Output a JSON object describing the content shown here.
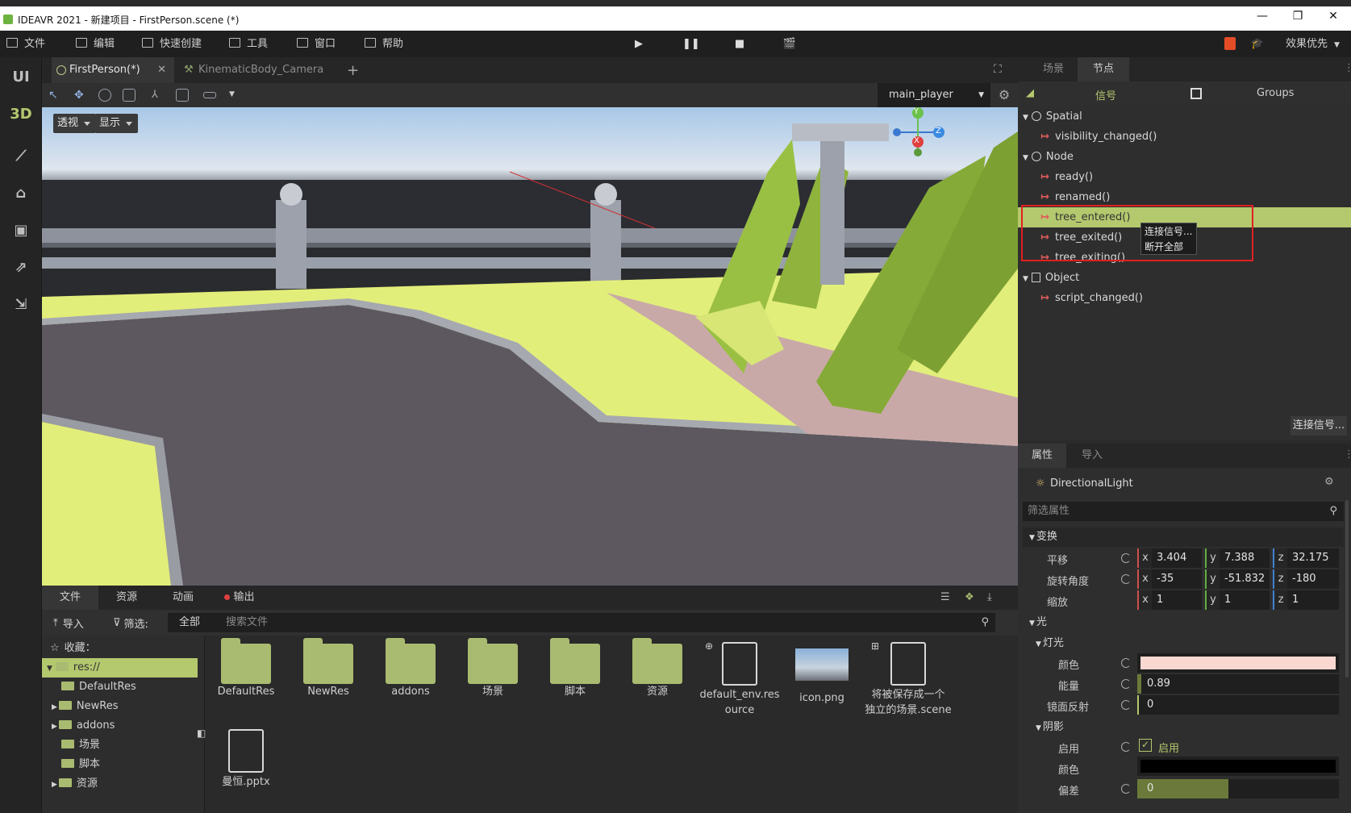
{
  "window": {
    "title": "IDEAVR 2021 - 新建项目 - FirstPerson.scene (*)",
    "controls": [
      "—",
      "❐",
      "✕"
    ]
  },
  "menu": {
    "items": [
      "文件",
      "编辑",
      "快速创建",
      "工具",
      "窗口",
      "帮助"
    ],
    "quality": "效果优先"
  },
  "leftbar": {
    "ui": "UI",
    "three_d": "3D"
  },
  "scene_tabs": [
    {
      "label": "FirstPerson(*)"
    },
    {
      "label": "KinematicBody_Camera"
    }
  ],
  "viewport": {
    "node_selector": "main_player",
    "projection": "透视",
    "display": "显示",
    "gizmo_axes": {
      "y": "Y",
      "x": "X",
      "z": "Z"
    }
  },
  "bottom_dock": {
    "tabs": [
      "文件",
      "资源",
      "动画",
      "输出"
    ],
    "import_label": "导入",
    "filter_label": "筛选:",
    "filter_value": "全部",
    "search_placeholder": "搜索文件",
    "favorites": "收藏：",
    "tree": [
      "res://",
      "DefaultRes",
      "NewRes",
      "addons",
      "场景",
      "脚本",
      "资源"
    ],
    "files": [
      {
        "name": "DefaultRes",
        "kind": "folder"
      },
      {
        "name": "NewRes",
        "kind": "folder"
      },
      {
        "name": "addons",
        "kind": "folder"
      },
      {
        "name": "场景",
        "kind": "folder"
      },
      {
        "name": "脚本",
        "kind": "folder"
      },
      {
        "name": "资源",
        "kind": "folder"
      },
      {
        "name": "default_env.res\nource",
        "kind": "file"
      },
      {
        "name": "icon.png",
        "kind": "image"
      },
      {
        "name": "将被保存成一个\n独立的场景.scene",
        "kind": "file"
      },
      {
        "name": "曼恒.pptx",
        "kind": "file"
      }
    ]
  },
  "right_dock": {
    "tabs": [
      "场景",
      "节点"
    ],
    "subtabs": {
      "signals": "信号",
      "groups": "Groups"
    },
    "signals": [
      {
        "type": "class",
        "label": "Spatial"
      },
      {
        "type": "signal",
        "label": "visibility_changed()"
      },
      {
        "type": "class",
        "label": "Node"
      },
      {
        "type": "signal",
        "label": "ready()"
      },
      {
        "type": "signal",
        "label": "renamed()"
      },
      {
        "type": "signal",
        "label": "tree_entered()",
        "selected": true
      },
      {
        "type": "signal",
        "label": "tree_exited()"
      },
      {
        "type": "signal",
        "label": "tree_exiting()"
      },
      {
        "type": "class",
        "label": "Object"
      },
      {
        "type": "signal",
        "label": "script_changed()"
      }
    ],
    "context_menu": [
      "连接信号...",
      "断开全部"
    ],
    "connect_button": "连接信号..."
  },
  "inspector": {
    "tabs": [
      "属性",
      "导入"
    ],
    "node_name": "DirectionalLight",
    "filter_placeholder": "筛选属性",
    "sections": {
      "transform": "变换",
      "light": "光",
      "light_sub": "灯光",
      "shadow": "阴影"
    },
    "props": {
      "translation": {
        "label": "平移",
        "x": "3.404",
        "y": "7.388",
        "z": "32.175"
      },
      "rotation": {
        "label": "旋转角度",
        "x": "-35",
        "y": "-51.832",
        "z": "-180"
      },
      "scale": {
        "label": "缩放",
        "x": "1",
        "y": "1",
        "z": "1"
      },
      "light_color": {
        "label": "颜色",
        "color": "#f8d8d0"
      },
      "energy": {
        "label": "能量",
        "value": "0.89",
        "fraction": 0.02
      },
      "specular": {
        "label": "镜面反射",
        "value": "0"
      },
      "shadow_enabled": {
        "label": "启用",
        "text": "启用",
        "checked": true
      },
      "shadow_color": {
        "label": "颜色",
        "color": "#000000"
      },
      "bias": {
        "label": "偏差",
        "value": "0",
        "fraction": 0.45
      }
    }
  },
  "colors": {
    "accent": "#b4c86e",
    "highlight_red": "#e02020",
    "signal_icon": "#e05a5a"
  }
}
